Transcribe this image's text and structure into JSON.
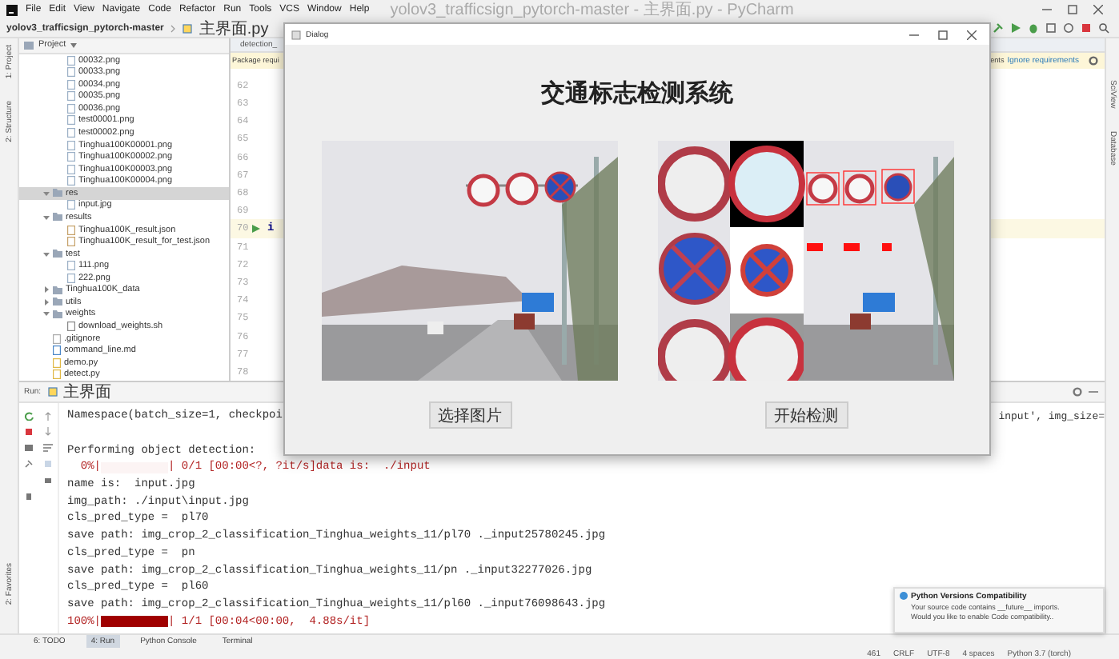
{
  "ide": {
    "menu": [
      "File",
      "Edit",
      "View",
      "Navigate",
      "Code",
      "Refactor",
      "Run",
      "Tools",
      "VCS",
      "Window",
      "Help"
    ],
    "title": "yolov3_trafficsign_pytorch-master - 主界面.py - PyCharm",
    "breadcrumb": [
      "yolov3_trafficsign_pytorch-master",
      "主界面.py"
    ],
    "left_tool_labels": [
      "1: Project",
      "2: Structure"
    ],
    "favorites_label": "2: Favorites",
    "right_tool_labels": [
      "SciView",
      "Database"
    ]
  },
  "project": {
    "header": "Project",
    "continued_files": [
      {
        "name": "00032.png",
        "kind": "image",
        "selected": false
      },
      {
        "name": "00033.png",
        "kind": "image",
        "selected": false
      },
      {
        "name": "00034.png",
        "kind": "image",
        "selected": false
      },
      {
        "name": "00035.png",
        "kind": "image",
        "selected": false
      },
      {
        "name": "00036.png",
        "kind": "image",
        "selected": false
      },
      {
        "name": "test00001.png",
        "kind": "image",
        "selected": false
      },
      {
        "name": "test00002.png",
        "kind": "image",
        "selected": false
      },
      {
        "name": "Tinghua100K00001.png",
        "kind": "image",
        "selected": false
      },
      {
        "name": "Tinghua100K00002.png",
        "kind": "image",
        "selected": false
      },
      {
        "name": "Tinghua100K00003.png",
        "kind": "image",
        "selected": false
      },
      {
        "name": "Tinghua100K00004.png",
        "kind": "image",
        "selected": false
      }
    ],
    "nodes": [
      {
        "name": "res",
        "kind": "folder",
        "expanded": true,
        "selected": true,
        "children": [
          {
            "name": "input.jpg",
            "kind": "image",
            "selected": false
          }
        ]
      },
      {
        "name": "results",
        "kind": "folder",
        "expanded": true,
        "selected": false,
        "children": [
          {
            "name": "Tinghua100K_result.json",
            "kind": "json",
            "selected": false
          },
          {
            "name": "Tinghua100K_result_for_test.json",
            "kind": "json",
            "selected": false
          }
        ]
      },
      {
        "name": "test",
        "kind": "folder",
        "expanded": true,
        "selected": false,
        "children": [
          {
            "name": "111.png",
            "kind": "image",
            "selected": false
          },
          {
            "name": "222.png",
            "kind": "image",
            "selected": false
          }
        ]
      },
      {
        "name": "Tinghua100K_data",
        "kind": "folder",
        "expanded": false,
        "selected": false
      },
      {
        "name": "utils",
        "kind": "folder",
        "expanded": false,
        "selected": false
      },
      {
        "name": "weights",
        "kind": "folder",
        "expanded": true,
        "selected": false,
        "children": [
          {
            "name": "download_weights.sh",
            "kind": "script",
            "selected": false
          }
        ]
      },
      {
        "name": ".gitignore",
        "kind": "text",
        "selected": false
      },
      {
        "name": "command_line.md",
        "kind": "markdown",
        "selected": false
      },
      {
        "name": "demo.py",
        "kind": "python",
        "selected": false
      },
      {
        "name": "detect.py",
        "kind": "python",
        "selected": false
      }
    ]
  },
  "editor": {
    "tab": "detection_",
    "banner": {
      "text": "Package requi",
      "tail": "ents",
      "action": "Ignore requirements"
    },
    "lines": [
      {
        "number": "62",
        "run_marker": false,
        "current": false
      },
      {
        "number": "63",
        "run_marker": false,
        "current": false
      },
      {
        "number": "64",
        "run_marker": false,
        "current": false
      },
      {
        "number": "65",
        "run_marker": false,
        "current": false
      },
      {
        "number": "66",
        "run_marker": false,
        "current": false
      },
      {
        "number": "67",
        "run_marker": false,
        "current": false
      },
      {
        "number": "68",
        "run_marker": false,
        "current": false
      },
      {
        "number": "69",
        "run_marker": false,
        "current": false
      },
      {
        "number": "70",
        "run_marker": true,
        "current": true,
        "code": "i"
      },
      {
        "number": "71",
        "run_marker": false,
        "current": false
      },
      {
        "number": "72",
        "run_marker": false,
        "current": false
      },
      {
        "number": "73",
        "run_marker": false,
        "current": false
      },
      {
        "number": "74",
        "run_marker": false,
        "current": false
      },
      {
        "number": "75",
        "run_marker": false,
        "current": false
      },
      {
        "number": "76",
        "run_marker": false,
        "current": false
      },
      {
        "number": "77",
        "run_marker": false,
        "current": false
      },
      {
        "number": "78",
        "run_marker": false,
        "current": false
      }
    ]
  },
  "run": {
    "label": "Run:",
    "tab": "主界面",
    "lines": [
      {
        "kind": "split",
        "text": "Namespace(batch_size=1, checkpoi",
        "tail": "input', img_size="
      },
      {
        "kind": "blank"
      },
      {
        "kind": "text",
        "text": "Performing object detection:"
      },
      {
        "kind": "progress",
        "prefix": "  0%|",
        "level": 0,
        "suffix": "| 0/1 [00:00<?, ?it/s]data is:  ./input"
      },
      {
        "kind": "text",
        "text": "name is:  input.jpg"
      },
      {
        "kind": "text",
        "text": "img_path: ./input\\input.jpg"
      },
      {
        "kind": "text",
        "text": "cls_pred_type =  pl70"
      },
      {
        "kind": "text",
        "text": "save path: img_crop_2_classification_Tinghua_weights_11/pl70 ._input25780245.jpg"
      },
      {
        "kind": "text",
        "text": "cls_pred_type =  pn"
      },
      {
        "kind": "text",
        "text": "save path: img_crop_2_classification_Tinghua_weights_11/pn ._input32277026.jpg"
      },
      {
        "kind": "text",
        "text": "cls_pred_type =  pl60"
      },
      {
        "kind": "text",
        "text": "save path: img_crop_2_classification_Tinghua_weights_11/pl60 ._input76098643.jpg"
      },
      {
        "kind": "progress",
        "prefix": "100%|",
        "level": 1,
        "suffix": "| 1/1 [00:04<00:00,  4.88s/it]"
      }
    ]
  },
  "tool_tabs": [
    {
      "label": "6: TODO",
      "selected": false
    },
    {
      "label": "4: Run",
      "selected": true
    },
    {
      "label": "Python Console",
      "selected": false
    },
    {
      "label": "Terminal",
      "selected": false
    }
  ],
  "status_bar": [
    "461",
    "CRLF",
    "UTF-8",
    "4 spaces",
    "Python 3.7 (torch)"
  ],
  "notification": {
    "title": "Python Versions Compatibility",
    "lines": [
      "Your source code contains __future__ imports.",
      "Would you like to enable Code compatibility.."
    ]
  },
  "dialog": {
    "title": "Dialog",
    "heading": "交通标志检测系统",
    "buttons": [
      "选择图片",
      "开始检测"
    ]
  }
}
